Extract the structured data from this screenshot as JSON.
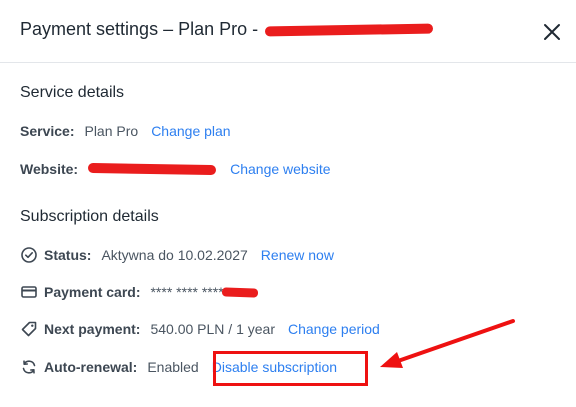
{
  "header": {
    "title": "Payment settings – Plan Pro -",
    "close_icon": "close-icon"
  },
  "service_details": {
    "heading": "Service details",
    "service_label": "Service:",
    "service_value": "Plan Pro",
    "change_plan": "Change plan",
    "website_label": "Website:",
    "change_website": "Change website"
  },
  "subscription": {
    "heading": "Subscription details",
    "status_label": "Status:",
    "status_value": "Aktywna do 10.02.2027",
    "renew_now": "Renew now",
    "payment_card_label": "Payment card:",
    "payment_card_value": "**** **** ****",
    "next_payment_label": "Next payment:",
    "next_payment_value": "540.00 PLN / 1 year",
    "change_period": "Change period",
    "auto_renewal_label": "Auto-renewal:",
    "auto_renewal_value": "Enabled",
    "disable_subscription": "Disable subscription"
  },
  "icons": [
    "check-circle-icon",
    "credit-card-icon",
    "tag-icon",
    "refresh-icon"
  ],
  "colors": {
    "link": "#2d7ff0",
    "annotation": "#ee1111",
    "text": "#1f2933"
  }
}
